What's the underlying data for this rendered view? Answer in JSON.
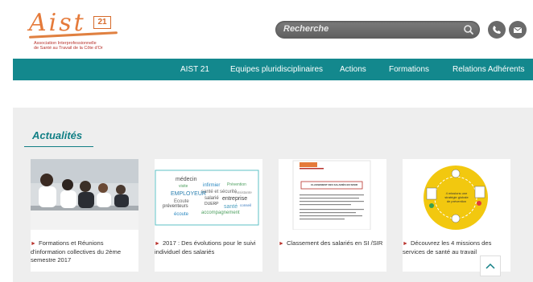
{
  "header": {
    "logo": {
      "wordmark": "Aist",
      "number": "21",
      "tagline_line1": "Association Interprofessionnelle",
      "tagline_line2": "de Santé au Travail de la Côte d'Or"
    },
    "search": {
      "placeholder": "Recherche",
      "icon": "search-icon"
    },
    "phone_icon": "phone-icon",
    "mail_icon": "mail-icon"
  },
  "nav": {
    "items": [
      "AIST 21",
      "Equipes pluridisciplinaires",
      "Actions",
      "Formations",
      "Relations Adhérents"
    ]
  },
  "news": {
    "title": "Actualités",
    "cards": [
      {
        "text": "Formations et Réunions d'information collectives du 2ème semestre 2017",
        "image": "training-meeting-photo"
      },
      {
        "text": "2017 : Des évolutions pour le suivi individuel des salariés",
        "image": "word-cloud-image"
      },
      {
        "text": "Classement des salariés en SI /SIR",
        "image": "document-thumbnail"
      },
      {
        "text": "Découvrez les 4 missions des services de santé au travail",
        "image": "missions-diagram"
      }
    ]
  },
  "word_cloud": {
    "words": [
      "médecin",
      "infirmier",
      "Prévention",
      "santé et sécurité",
      "EMPLOYEUR",
      "salarié",
      "entreprise",
      "conseil",
      "DUERP",
      "santé",
      "préventeurs",
      "accompagnement",
      "écoute",
      "Ecoute",
      "visite",
      "Assistante"
    ]
  },
  "document_thumb": {
    "title": "CLASSEMENT DES SALARIÉS EN SI/SIR"
  },
  "missions_diagram": {
    "center_text": "4 missions une stratégie globale de prévention"
  },
  "scroll_top": {
    "icon": "chevron-up-icon"
  },
  "colors": {
    "teal": "#13888d",
    "accent_red": "#b8322c",
    "logo_orange": "#e57a3a",
    "search_gray": "#6e6e6e"
  }
}
